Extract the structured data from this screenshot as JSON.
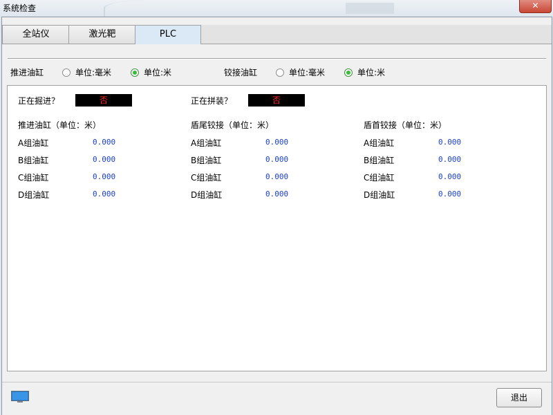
{
  "window": {
    "title": "系统检查",
    "close_label": "✕"
  },
  "tabs": [
    {
      "label": "全站仪",
      "active": false
    },
    {
      "label": "激光靶",
      "active": false
    },
    {
      "label": "PLC",
      "active": true
    }
  ],
  "unit_options": {
    "push_cylinder": {
      "label": "推进油缸",
      "options": [
        {
          "label": "单位:毫米",
          "checked": false
        },
        {
          "label": "单位:米",
          "checked": true
        }
      ]
    },
    "hinge_cylinder": {
      "label": "铰接油缸",
      "options": [
        {
          "label": "单位:毫米",
          "checked": false
        },
        {
          "label": "单位:米",
          "checked": true
        }
      ]
    }
  },
  "status": {
    "excavating": {
      "label": "正在掘进？",
      "value": "否"
    },
    "assembling": {
      "label": "正在拼装？",
      "value": "否"
    }
  },
  "groups": [
    {
      "title": "推进油缸（单位：米）",
      "rows": [
        {
          "label": "A组油缸",
          "value": "0.000"
        },
        {
          "label": "B组油缸",
          "value": "0.000"
        },
        {
          "label": "C组油缸",
          "value": "0.000"
        },
        {
          "label": "D组油缸",
          "value": "0.000"
        }
      ]
    },
    {
      "title": "盾尾铰接（单位：米）",
      "rows": [
        {
          "label": "A组油缸",
          "value": "0.000"
        },
        {
          "label": "B组油缸",
          "value": "0.000"
        },
        {
          "label": "C组油缸",
          "value": "0.000"
        },
        {
          "label": "D组油缸",
          "value": "0.000"
        }
      ]
    },
    {
      "title": "盾首铰接（单位：米）",
      "rows": [
        {
          "label": "A组油缸",
          "value": "0.000"
        },
        {
          "label": "B组油缸",
          "value": "0.000"
        },
        {
          "label": "C组油缸",
          "value": "0.000"
        },
        {
          "label": "D组油缸",
          "value": "0.000"
        }
      ]
    }
  ],
  "footer": {
    "exit_label": "退出",
    "icon": "monitor-icon"
  },
  "colors": {
    "value_blue": "#1a3fcf",
    "indicator_red": "#ff2a2a",
    "radio_green": "#3cbc3c"
  }
}
